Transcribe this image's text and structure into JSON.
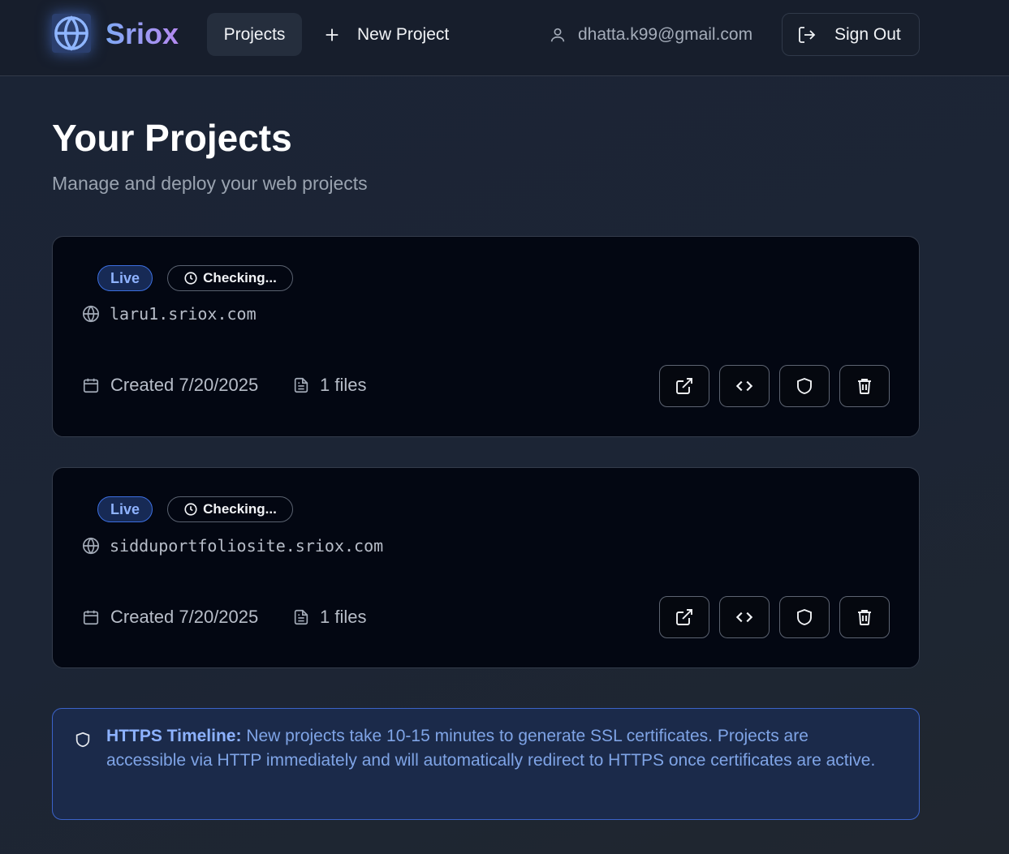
{
  "header": {
    "brand": "Sriox",
    "nav_projects": "Projects",
    "nav_new_project": "New Project",
    "user_email": "dhatta.k99@gmail.com",
    "sign_out": "Sign Out"
  },
  "page": {
    "title": "Your Projects",
    "subtitle": "Manage and deploy your web projects"
  },
  "projects": [
    {
      "status": "Live",
      "ssl_status": "Checking...",
      "domain": "laru1.sriox.com",
      "created": "Created 7/20/2025",
      "files": "1 files"
    },
    {
      "status": "Live",
      "ssl_status": "Checking...",
      "domain": "sidduportfoliosite.sriox.com",
      "created": "Created 7/20/2025",
      "files": "1 files"
    }
  ],
  "notice": {
    "label": "HTTPS Timeline:",
    "text": " New projects take 10-15 minutes to generate SSL certificates. Projects are accessible via HTTP immediately and will automatically redirect to HTTPS once certificates are active."
  },
  "icons": {
    "logo": "globe-icon",
    "new_project": "plus-icon",
    "user": "user-icon",
    "sign_out": "log-out-icon",
    "domain": "globe-icon",
    "created": "calendar-icon",
    "files": "file-text-icon",
    "open": "external-link-icon",
    "code": "code-icon",
    "ssl": "shield-icon",
    "delete": "trash-icon",
    "clock": "clock-icon"
  },
  "colors": {
    "accent": "#3c6fe0",
    "live_text": "#8fb3ff",
    "notice_bg": "#1b2a4a",
    "card_bg": "#030712"
  }
}
